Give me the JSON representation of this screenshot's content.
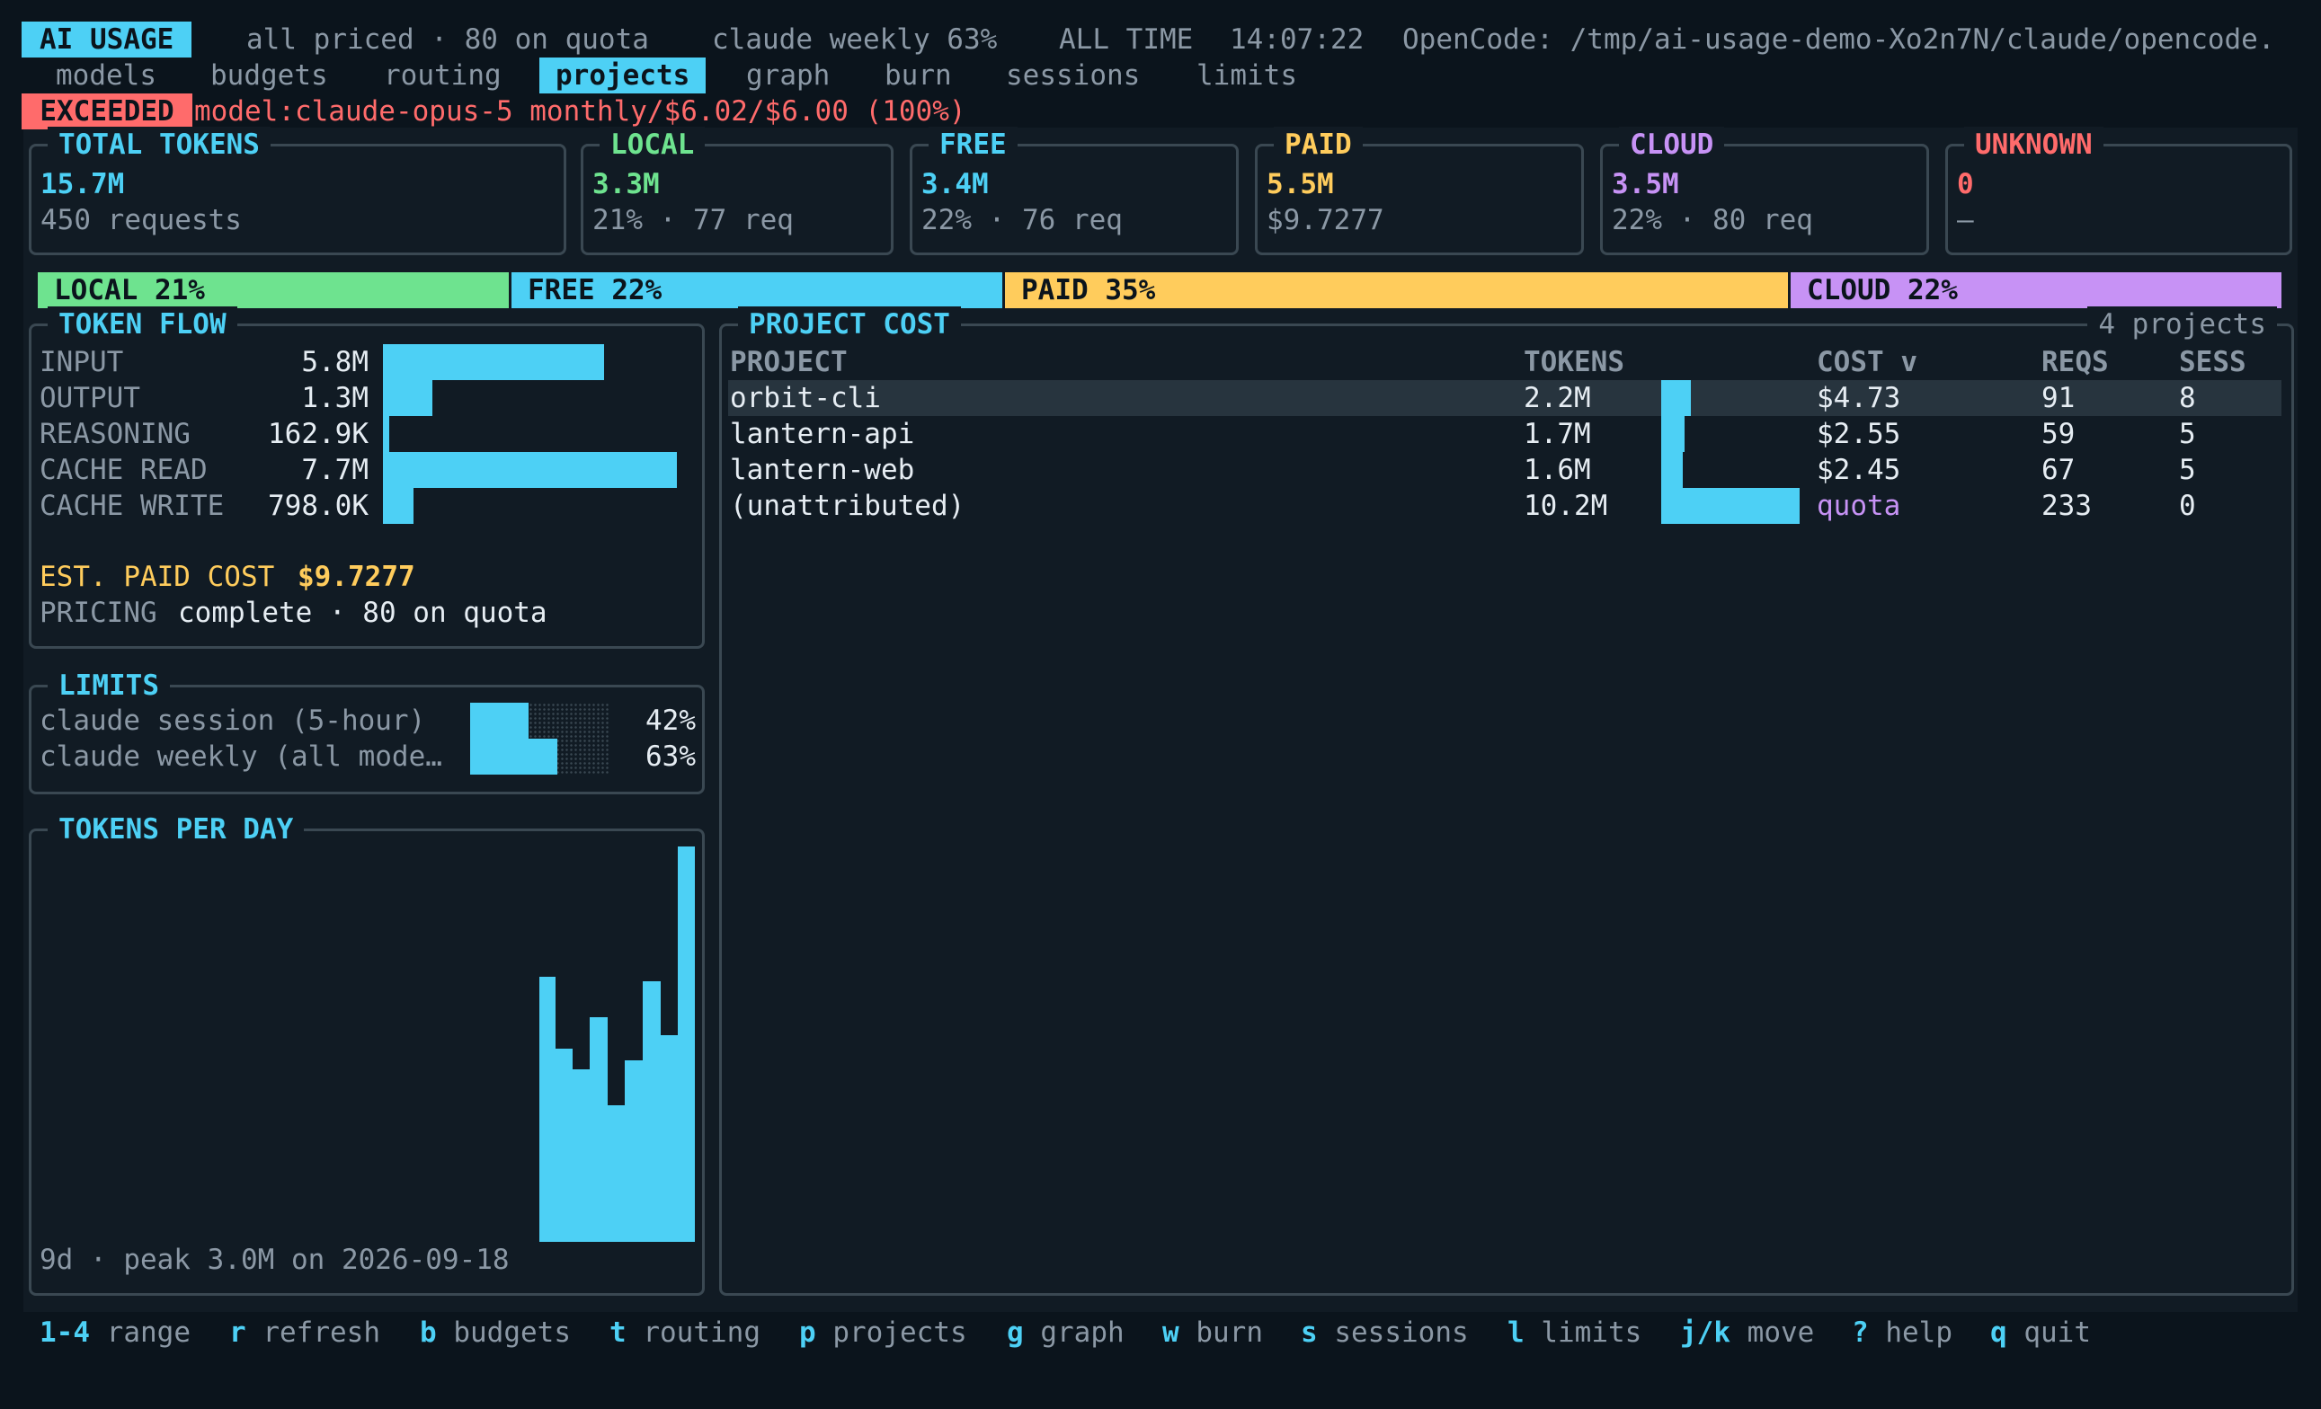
{
  "header": {
    "app_badge": "AI USAGE",
    "pricing_status": "all priced · 80 on quota",
    "weekly_status": "claude weekly 63%",
    "range": "ALL TIME",
    "clock": "14:07:22",
    "source_path": "OpenCode: /tmp/ai-usage-demo-Xo2n7N/claude/opencode."
  },
  "nav": {
    "tabs": [
      "models",
      "budgets",
      "routing",
      "projects",
      "graph",
      "burn",
      "sessions",
      "limits"
    ],
    "active_tab": "projects"
  },
  "alert": {
    "badge": "EXCEEDED",
    "message": "model:claude-opus-5 monthly/$6.02/$6.00 (100%)"
  },
  "summary_cards": [
    {
      "title": "TOTAL TOKENS",
      "value": "15.7M",
      "detail": "450 requests",
      "color": "#4dd0f5"
    },
    {
      "title": "LOCAL",
      "value": "3.3M",
      "detail": "21% · 77 req",
      "color": "#6ee38f"
    },
    {
      "title": "FREE",
      "value": "3.4M",
      "detail": "22% · 76 req",
      "color": "#4dd0f5"
    },
    {
      "title": "PAID",
      "value": "5.5M",
      "detail": "$9.7277",
      "color": "#ffcc5c"
    },
    {
      "title": "CLOUD",
      "value": "3.5M",
      "detail": "22% · 80 req",
      "color": "#c792f5"
    },
    {
      "title": "UNKNOWN",
      "value": "0",
      "detail": "—",
      "color": "#ff6b6b"
    }
  ],
  "share_bar": [
    {
      "label": "LOCAL 21%",
      "percent": 21,
      "color": "#6ee38f"
    },
    {
      "label": "FREE 22%",
      "percent": 22,
      "color": "#4dd0f5"
    },
    {
      "label": "PAID 35%",
      "percent": 35,
      "color": "#ffcc5c"
    },
    {
      "label": "CLOUD 22%",
      "percent": 22,
      "color": "#c792f5"
    }
  ],
  "token_flow": {
    "title": "TOKEN FLOW",
    "rows": [
      {
        "label": "INPUT",
        "value": "5.8M",
        "amount": 5.8
      },
      {
        "label": "OUTPUT",
        "value": "1.3M",
        "amount": 1.3
      },
      {
        "label": "REASONING",
        "value": "162.9K",
        "amount": 0.1629
      },
      {
        "label": "CACHE READ",
        "value": "7.7M",
        "amount": 7.7
      },
      {
        "label": "CACHE WRITE",
        "value": "798.0K",
        "amount": 0.798
      }
    ],
    "est_paid_cost_label": "EST. PAID COST",
    "est_paid_cost_value": "$9.7277",
    "pricing_label": "PRICING",
    "pricing_value": "complete · 80 on quota"
  },
  "limits": {
    "title": "LIMITS",
    "rows": [
      {
        "label": "claude session (5-hour)",
        "percent_text": "42%",
        "percent": 42
      },
      {
        "label": "claude weekly (all mode…",
        "percent_text": "63%",
        "percent": 63
      }
    ]
  },
  "tokens_per_day": {
    "title": "TOKENS PER DAY",
    "footer": "9d · peak 3.0M on 2026-09-18"
  },
  "project_cost": {
    "title": "PROJECT COST",
    "count": "4 projects",
    "columns": [
      "PROJECT",
      "TOKENS",
      "COST v",
      "REQS",
      "SESS"
    ],
    "rows": [
      {
        "project": "orbit-cli",
        "tokens": "2.2M",
        "tokens_m": 2.2,
        "cost": "$4.73",
        "reqs": "91",
        "sess": "8",
        "selected": true,
        "cost_color": "#e6edf3"
      },
      {
        "project": "lantern-api",
        "tokens": "1.7M",
        "tokens_m": 1.7,
        "cost": "$2.55",
        "reqs": "59",
        "sess": "5",
        "selected": false,
        "cost_color": "#e6edf3"
      },
      {
        "project": "lantern-web",
        "tokens": "1.6M",
        "tokens_m": 1.6,
        "cost": "$2.45",
        "reqs": "67",
        "sess": "5",
        "selected": false,
        "cost_color": "#e6edf3"
      },
      {
        "project": "(unattributed)",
        "tokens": "10.2M",
        "tokens_m": 10.2,
        "cost": "quota",
        "reqs": "233",
        "sess": "0",
        "selected": false,
        "cost_color": "#c792f5"
      }
    ]
  },
  "footer_keys": [
    {
      "key": "1-4",
      "action": "range"
    },
    {
      "key": "r",
      "action": "refresh"
    },
    {
      "key": "b",
      "action": "budgets"
    },
    {
      "key": "t",
      "action": "routing"
    },
    {
      "key": "p",
      "action": "projects"
    },
    {
      "key": "g",
      "action": "graph"
    },
    {
      "key": "w",
      "action": "burn"
    },
    {
      "key": "s",
      "action": "sessions"
    },
    {
      "key": "l",
      "action": "limits"
    },
    {
      "key": "j/k",
      "action": "move"
    },
    {
      "key": "?",
      "action": "help"
    },
    {
      "key": "q",
      "action": "quit"
    }
  ]
}
